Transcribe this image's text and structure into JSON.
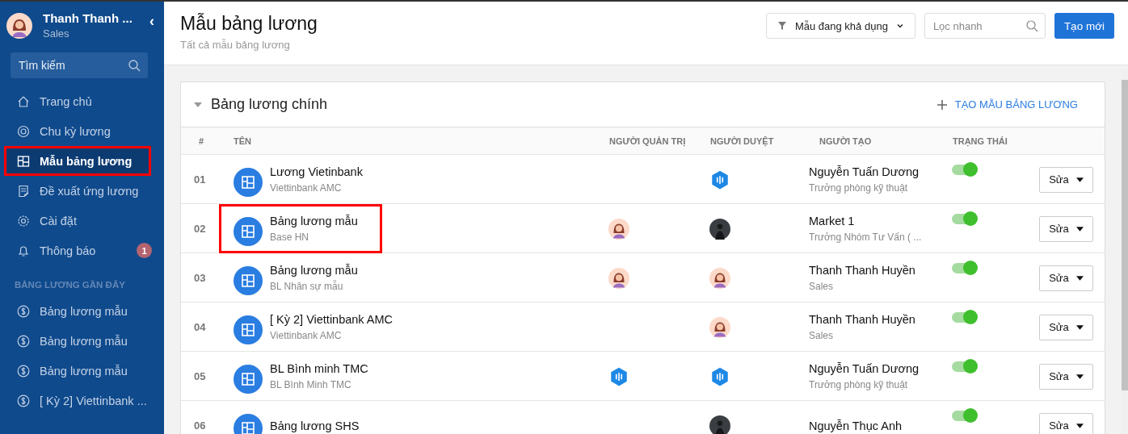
{
  "sidebar": {
    "user": {
      "name": "Thanh Thanh ...",
      "role": "Sales"
    },
    "collapse": "‹",
    "search": {
      "placeholder": "Tìm kiếm"
    },
    "items": [
      {
        "label": "Trang chủ",
        "kind": "home",
        "selected": false,
        "highlighted": false
      },
      {
        "label": "Chu kỳ lương",
        "kind": "cycle",
        "selected": false,
        "highlighted": false
      },
      {
        "label": "Mẫu bảng lương",
        "kind": "template",
        "selected": true,
        "highlighted": true
      },
      {
        "label": "Đề xuất ứng lương",
        "kind": "doc",
        "selected": false,
        "highlighted": false
      },
      {
        "label": "Cài đặt",
        "kind": "gear",
        "selected": false,
        "highlighted": false
      },
      {
        "label": "Thông báo",
        "kind": "bell",
        "selected": false,
        "highlighted": false,
        "badge": "1"
      }
    ],
    "recent_heading": "BẢNG LƯƠNG GẦN ĐÂY",
    "recent": [
      "Bảng lương mẫu",
      "Bảng lương mẫu",
      "Bảng lương mẫu",
      "[ Kỳ 2] Viettinbank ..."
    ]
  },
  "header": {
    "title": "Mẫu bảng lương",
    "subtitle": "Tất cả mẫu bảng lương",
    "filter": "Mẫu đang khả dụng",
    "search": {
      "placeholder": "Lọc nhanh"
    },
    "create_button": "Tạo mới"
  },
  "section": {
    "title": "Bảng lương chính",
    "expanded": true,
    "add_link": "TẠO MẪU BẢNG LƯƠNG",
    "columns": [
      "#",
      "TÊN",
      "NGƯỜI QUẢN TRỊ",
      "NGƯỜI DUYỆT",
      "NGƯỜI TẠO",
      "TRẠNG THÁI"
    ],
    "rows": [
      {
        "index": "01",
        "name": "Lương Vietinbank",
        "group": "Viettinbank AMC",
        "highlighted": false,
        "approver": {
          "kind": "logo"
        },
        "creator": "Nguyễn Tuấn Dương",
        "creator_role": "Trưởng phòng kỹ thuật",
        "on": true,
        "action": "Sửa"
      },
      {
        "index": "02",
        "name": "Bảng lương mẫu",
        "group": "Base HN",
        "highlighted": true,
        "admin": {
          "kind": "person"
        },
        "approver": {
          "kind": "photo"
        },
        "creator": "Market 1",
        "creator_role": "Trưởng Nhóm Tư Vấn ( ...",
        "on": true,
        "action": "Sửa"
      },
      {
        "index": "03",
        "name": "Bảng lương mẫu",
        "group": "BL Nhân sự mẫu",
        "highlighted": false,
        "admin": {
          "kind": "person"
        },
        "approver": {
          "kind": "person"
        },
        "creator": "Thanh Thanh Huyền",
        "creator_role": "Sales",
        "on": true,
        "action": "Sửa"
      },
      {
        "index": "04",
        "name": "[ Kỳ 2] Viettinbank AMC",
        "group": "Viettinbank AMC",
        "highlighted": false,
        "approver": {
          "kind": "person"
        },
        "creator": "Thanh Thanh Huyền",
        "creator_role": "Sales",
        "on": true,
        "action": "Sửa"
      },
      {
        "index": "05",
        "name": "BL Bình minh TMC",
        "group": "BL Bình Minh TMC",
        "highlighted": false,
        "admin": {
          "kind": "logo"
        },
        "approver": {
          "kind": "logo"
        },
        "creator": "Nguyễn Tuấn Dương",
        "creator_role": "Trưởng phòng kỹ thuật",
        "on": true,
        "action": "Sửa"
      },
      {
        "index": "06",
        "name": "Bảng lương SHS",
        "highlighted": false,
        "approver": {
          "kind": "photo"
        },
        "creator": "Nguyễn Thục Anh",
        "on": true,
        "action": "Sửa"
      }
    ]
  }
}
